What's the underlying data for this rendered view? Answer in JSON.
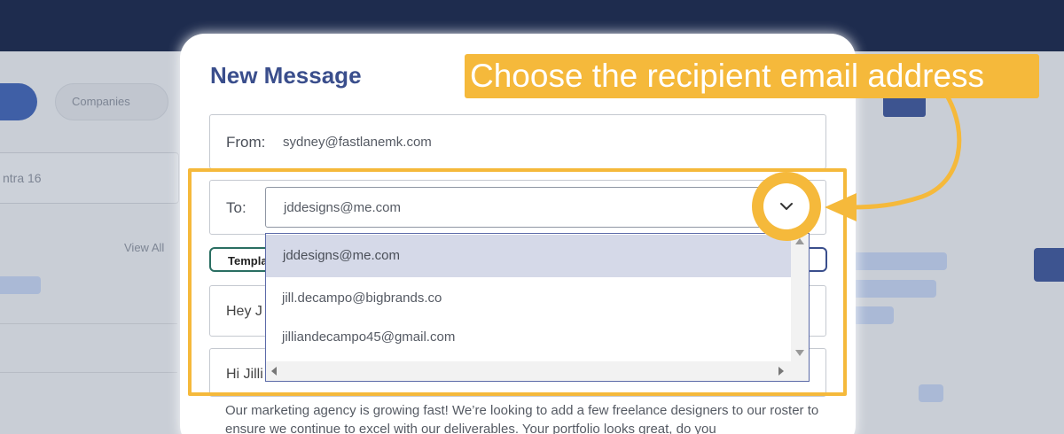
{
  "background": {
    "tab_label": "Companies",
    "search_hint": "ntra 16",
    "link_text": "View All"
  },
  "modal": {
    "title": "New Message",
    "from_label": "From:",
    "from_value": "sydney@fastlanemk.com",
    "to_label": "To:",
    "to_value": "jddesigns@me.com",
    "template_label": "Templa",
    "subject_preview": "Hey J",
    "greeting_preview": "Hi Jilli",
    "body_text": "Our marketing agency is growing fast!  We’re looking to add a few freelance designers to our roster to ensure we continue to excel with our deliverables.  Your portfolio looks great, do you"
  },
  "dropdown": {
    "options": [
      "jddesigns@me.com",
      "jill.decampo@bigbrands.co",
      "jilliandecampo45@gmail.com"
    ],
    "selected_index": 0
  },
  "annotation": {
    "callout_text": "Choose the recipient email address",
    "accent_color": "#f5b93b"
  },
  "icons": {
    "dropdown_toggle": "chevron-down-icon"
  }
}
